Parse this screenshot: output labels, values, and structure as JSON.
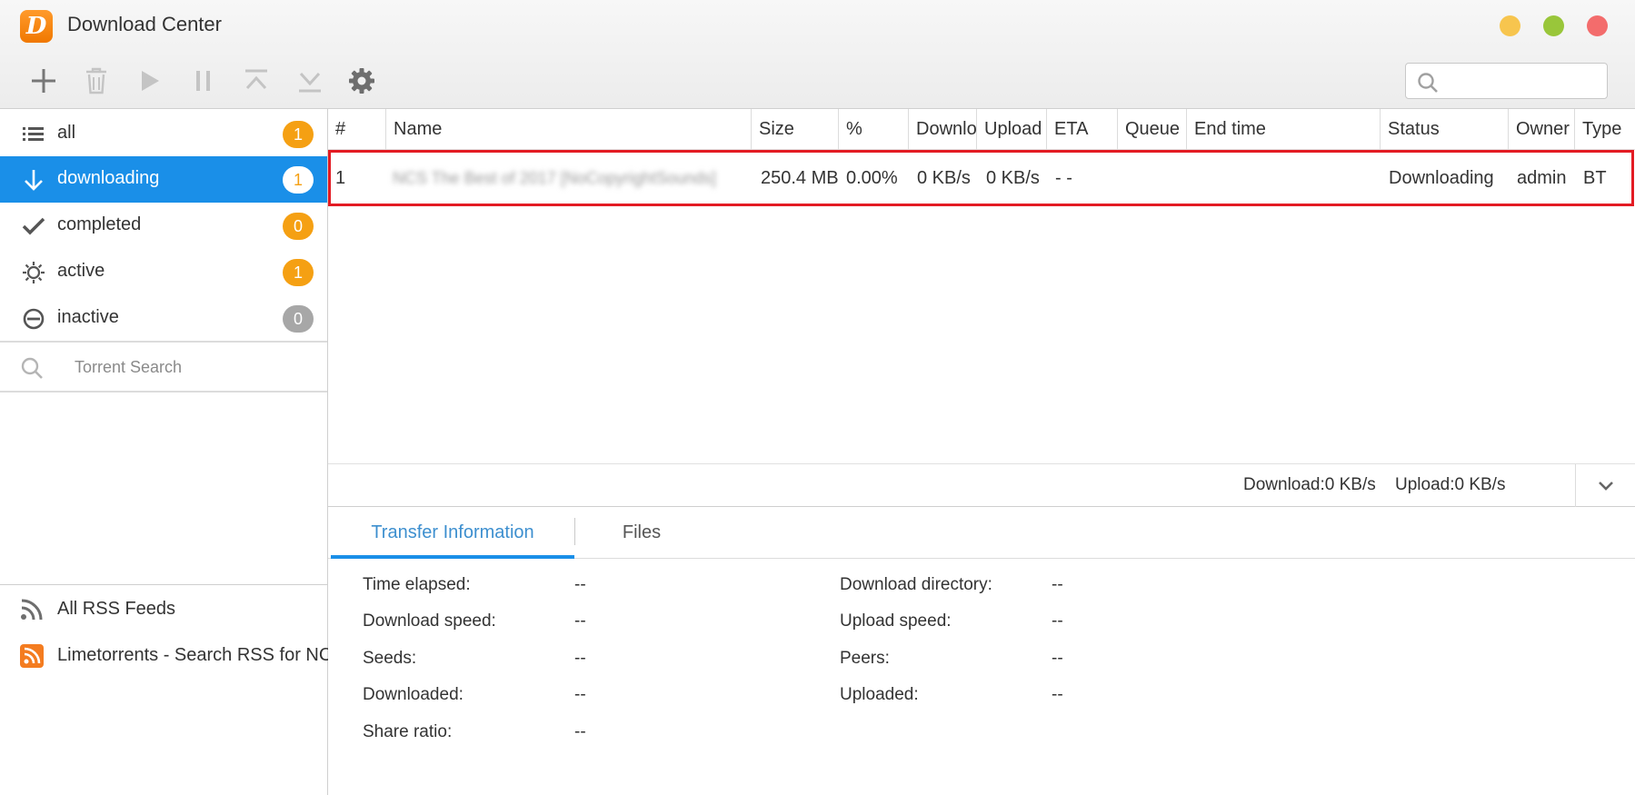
{
  "app": {
    "title": "Download Center",
    "logo_letter": "D"
  },
  "toolbar": {
    "items": [
      "add-icon",
      "trash-icon",
      "play-icon",
      "pause-icon",
      "move-top-icon",
      "move-bottom-icon",
      "gear-icon"
    ],
    "search_placeholder": ""
  },
  "sidebar": {
    "filters": [
      {
        "label": "all",
        "count": "1",
        "icon": "list-icon"
      },
      {
        "label": "downloading",
        "count": "1",
        "icon": "arrow-down-icon",
        "selected": true
      },
      {
        "label": "completed",
        "count": "0",
        "icon": "checkmark-icon"
      },
      {
        "label": "active",
        "count": "1",
        "icon": "sun-icon"
      },
      {
        "label": "inactive",
        "count": "0",
        "icon": "minus-circle-icon"
      }
    ],
    "torrent_search": "Torrent Search",
    "rss": [
      {
        "label": "All RSS Feeds",
        "icon": "rss-icon"
      },
      {
        "label": "Limetorrents - Search RSS for NCS",
        "icon": "rss-orange-icon"
      }
    ]
  },
  "table": {
    "columns": [
      "#",
      "Name",
      "Size",
      "%",
      "Downlo",
      "Upload",
      "ETA",
      "Queue",
      "End time",
      "Status",
      "Owner",
      "Type"
    ],
    "rows": [
      {
        "num": "1",
        "name": "NCS The Best of 2017 [NoCopyrightSounds]",
        "size": "250.4 MB",
        "percent": "0.00%",
        "download": "0 KB/s",
        "upload": "0 KB/s",
        "eta": "- -",
        "queue": "",
        "end_time": "",
        "status": "Downloading",
        "owner": "admin",
        "type": "BT"
      }
    ]
  },
  "speed": {
    "download": "Download:0 KB/s",
    "upload": "Upload:0 KB/s"
  },
  "details": {
    "tabs": [
      "Transfer Information",
      "Files"
    ],
    "left": [
      {
        "label": "Time elapsed:",
        "value": "--"
      },
      {
        "label": "Download speed:",
        "value": "--"
      },
      {
        "label": "Seeds:",
        "value": "--"
      },
      {
        "label": "Downloaded:",
        "value": "--"
      },
      {
        "label": "Share ratio:",
        "value": "--"
      }
    ],
    "right": [
      {
        "label": "Download directory:",
        "value": "--"
      },
      {
        "label": "Upload speed:",
        "value": "--"
      },
      {
        "label": "Peers:",
        "value": "--"
      },
      {
        "label": "Uploaded:",
        "value": "--"
      }
    ]
  },
  "colors": {
    "accent": "#1a8fe8",
    "badge": "#f5a013",
    "highlight": "#e31b23"
  }
}
